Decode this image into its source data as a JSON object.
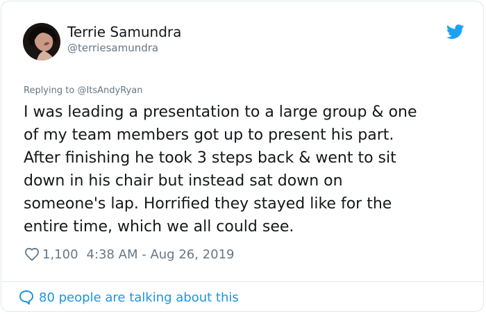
{
  "tweet": {
    "author_name": "Terrie Samundra",
    "author_handle": "@terriesamundra",
    "replying_prefix": "Replying to ",
    "replying_to": "@ItsAndyRyan",
    "text_lines": [
      "I was leading a presentation to a large group & one",
      "of my team members got up to present his part.",
      "After finishing he took 3 steps back & went to sit",
      "down in his chair but instead sat down on",
      "someone's lap. Horrified they stayed like for the",
      "entire time, which we all could see."
    ],
    "likes": "1,100",
    "timestamp": "4:38 AM - Aug 26, 2019",
    "talking": "80 people are talking about this"
  },
  "icons": {
    "brand": "twitter-bird-icon",
    "like": "heart-outline-icon",
    "talking": "speech-bubble-icon"
  },
  "colors": {
    "brand": "#1da1f2",
    "link": "#1b95e0",
    "secondary_text": "#657786",
    "border": "#e1e8ed"
  }
}
